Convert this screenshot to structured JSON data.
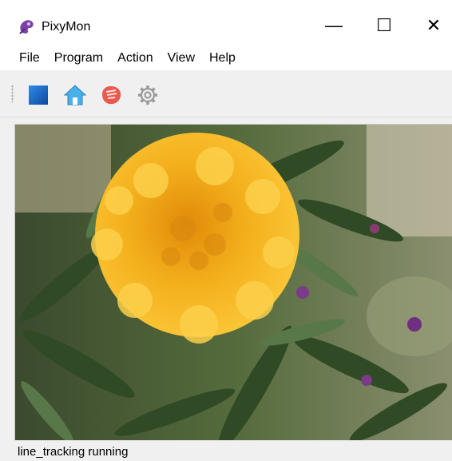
{
  "window": {
    "title": "PixyMon",
    "controls": {
      "minimize": "—",
      "maximize": "☐",
      "close": "✕"
    }
  },
  "menu": {
    "items": [
      "File",
      "Program",
      "Action",
      "View",
      "Help"
    ]
  },
  "toolbar": {
    "icons": [
      "stop-square-icon",
      "home-icon",
      "pixy-logo-icon",
      "gear-icon"
    ]
  },
  "video": {
    "subject": "marigold-flower-frame"
  },
  "status": {
    "text": "line_tracking running"
  },
  "colors": {
    "flower": "#f4b01c",
    "foliage": "#3f5a2e",
    "stop_icon": "#1565c0"
  }
}
